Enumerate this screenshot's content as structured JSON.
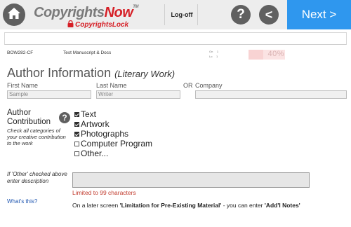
{
  "header": {
    "logo_main_prefix": "Copyrights",
    "logo_main_suffix": "Now",
    "logo_tm": "TM",
    "logo_sub": "CopyrightsLock",
    "logoff_label": "Log-off",
    "help_label": "?",
    "back_label": "<",
    "next_label": "Next >"
  },
  "status": {
    "case_id": "BOW282-CF",
    "case_title": "Test Manuscript & Docs",
    "mini_label_1": "On",
    "mini_label_2": "Lo",
    "mini_value_1": "1",
    "mini_value_2": "1",
    "progress_text": "40%",
    "progress_fraction": 0.4
  },
  "section": {
    "title": "Author Information",
    "subtitle": "(Literary Work)"
  },
  "name_fields": {
    "first_label": "First Name",
    "first_value": "Sample",
    "last_label": "Last Name",
    "last_value": "Writer",
    "or_label": "OR",
    "company_label": "Company",
    "company_value": ""
  },
  "contribution": {
    "title_line1": "Author",
    "title_line2": "Contribution",
    "help_label": "?",
    "hint": "Check all categories of your creative contribution to the work",
    "items": [
      {
        "label": "Text",
        "checked": true
      },
      {
        "label": "Artwork",
        "checked": true
      },
      {
        "label": "Photographs",
        "checked": true
      },
      {
        "label": "Computer Program",
        "checked": false
      },
      {
        "label": "Other...",
        "checked": false
      }
    ]
  },
  "other": {
    "hint": "If 'Other' checked above enter description",
    "value": "",
    "limit_text": "Limited to 99 characters",
    "whats_this": "What's this?",
    "note_prefix": "On a later screen ",
    "note_bold1": "'Limitation for Pre-Existing Material'",
    "note_mid": " - you can enter ",
    "note_bold2": "'Add'l Notes'"
  }
}
